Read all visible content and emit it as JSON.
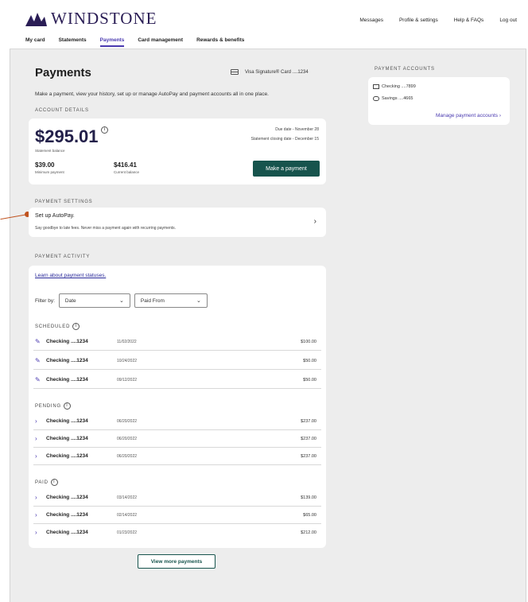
{
  "brand": {
    "name": "WINDSTONE"
  },
  "top_links": [
    "Messages",
    "Profile & settings",
    "Help & FAQs",
    "Log out"
  ],
  "nav": {
    "items": [
      "My card",
      "Statements",
      "Payments",
      "Card management",
      "Rewards & benefits"
    ],
    "active": "Payments"
  },
  "page": {
    "title": "Payments",
    "card_ref": "Visa Signature® Card ....1234",
    "intro": "Make a payment, view your history, set up or manage AutoPay and payment accounts all in one place."
  },
  "account": {
    "section": "ACCOUNT DETAILS",
    "balance": "$295.01",
    "balance_label": "Statement balance",
    "due": "Due date - November 28",
    "closing": "Statement closing date - December 15",
    "min_amount": "$39.00",
    "min_label": "Minimum payment",
    "current_amount": "$416.41",
    "current_label": "Current balance",
    "pay_button": "Make a payment"
  },
  "settings": {
    "section": "PAYMENT SETTINGS",
    "title": "Set up AutoPay.",
    "subtitle": "Say goodbye to late fees. Never miss a payment again with recurring payments."
  },
  "activity": {
    "section": "PAYMENT ACTIVITY",
    "learn_link": "Learn about payment statuses.",
    "filter_label": "Filter by:",
    "filter_date": "Date",
    "filter_from": "Paid From",
    "scheduled_label": "SCHEDULED",
    "pending_label": "PENDING",
    "paid_label": "PAID",
    "scheduled": [
      {
        "account": "Checking ....1234",
        "date": "11/02/2022",
        "amount": "$100.00"
      },
      {
        "account": "Checking ....1234",
        "date": "10/24/2022",
        "amount": "$50.00"
      },
      {
        "account": "Checking ....1234",
        "date": "09/12/2022",
        "amount": "$50.00"
      }
    ],
    "pending": [
      {
        "account": "Checking ....1234",
        "date": "06/20/2022",
        "amount": "$237.00"
      },
      {
        "account": "Checking ....1234",
        "date": "06/20/2022",
        "amount": "$237.00"
      },
      {
        "account": "Checking ....1234",
        "date": "06/20/2022",
        "amount": "$237.00"
      }
    ],
    "paid": [
      {
        "account": "Checking ....1234",
        "date": "03/14/2022",
        "amount": "$139.00"
      },
      {
        "account": "Checking ....1234",
        "date": "02/14/2022",
        "amount": "$65.00"
      },
      {
        "account": "Checking ....1234",
        "date": "01/23/2022",
        "amount": "$212.00"
      }
    ],
    "more_button": "View more payments"
  },
  "accounts_panel": {
    "section": "PAYMENT ACCOUNTS",
    "checking": "Checking ....7899",
    "savings": "Savings ....4665",
    "manage": "Manage payment accounts"
  }
}
